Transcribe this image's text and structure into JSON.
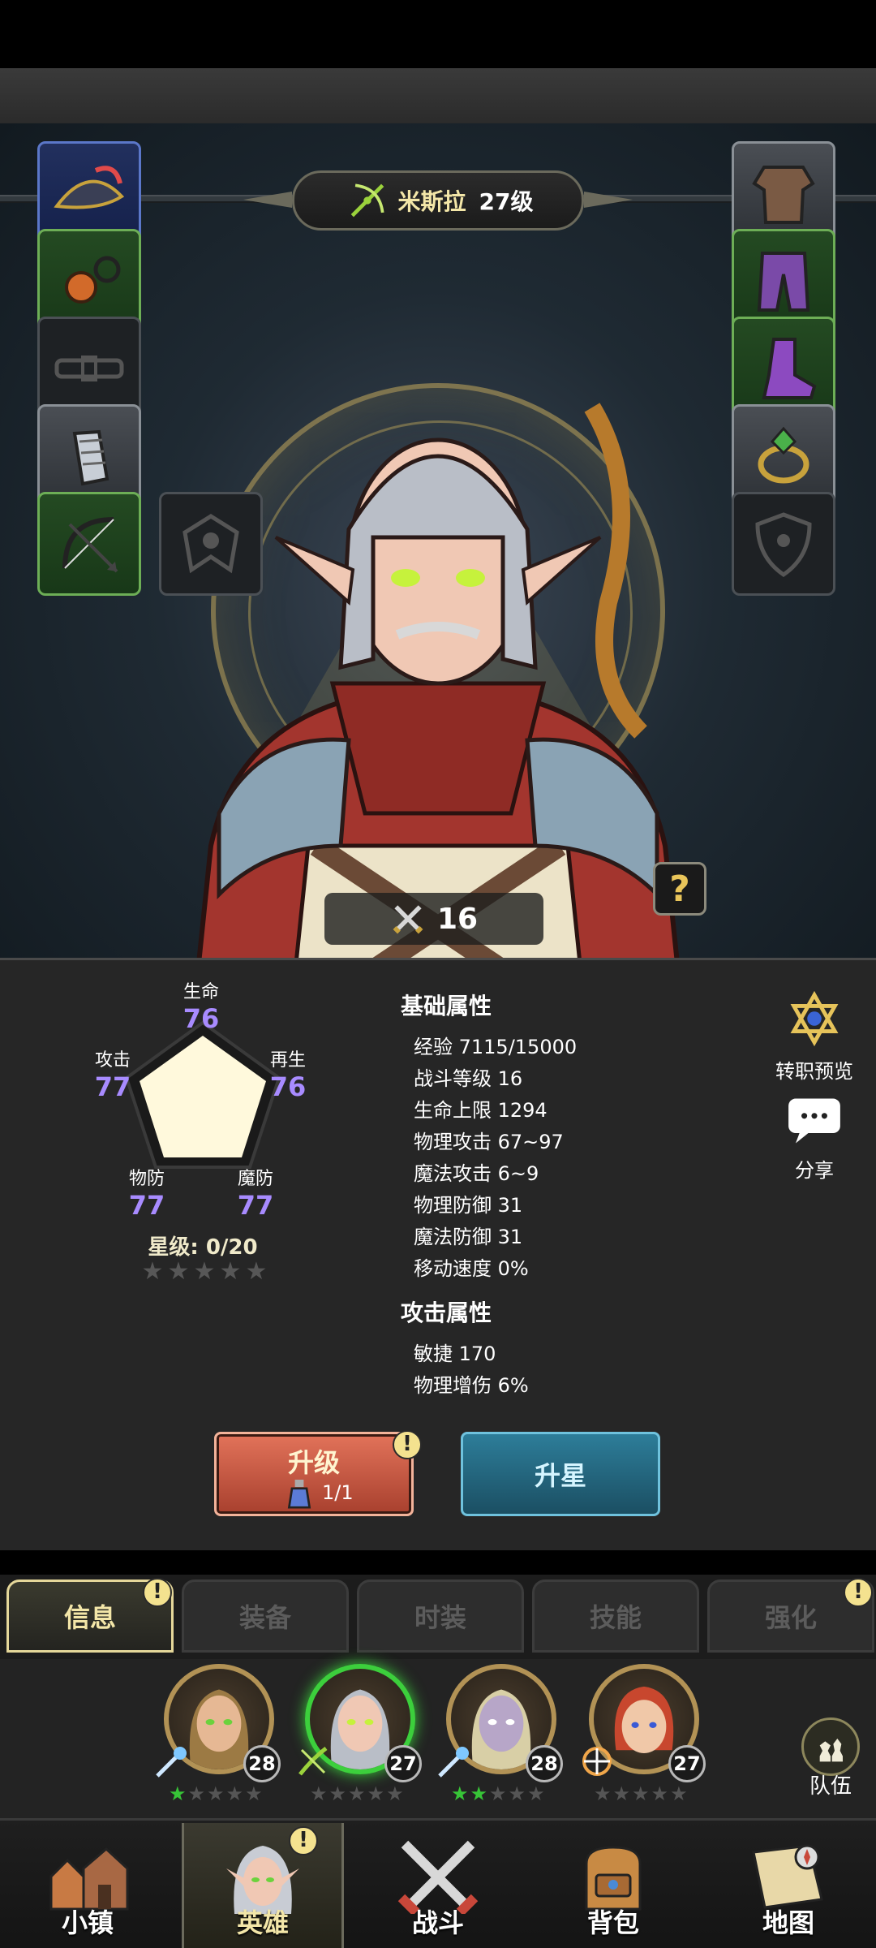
{
  "header": {
    "hero_name": "米斯拉",
    "hero_level": "27级"
  },
  "equipment": {
    "left": [
      "hat-icon",
      "amulet-icon",
      "belt-icon",
      "gauntlet-icon",
      "bow-icon"
    ],
    "right": [
      "chest-armor-icon",
      "pants-icon",
      "boots-icon",
      "ring-icon",
      "shield-icon"
    ],
    "extra": "emblem-icon"
  },
  "power": {
    "value": "16"
  },
  "radar": {
    "labels": {
      "life": "生命",
      "regen": "再生",
      "magic_def": "魔防",
      "phys_def": "物防",
      "attack": "攻击"
    },
    "values": {
      "life": "76",
      "regen": "76",
      "magic_def": "77",
      "phys_def": "77",
      "attack": "77"
    }
  },
  "star_level": {
    "label": "星级: 0/20",
    "stars_filled": 0,
    "stars_total": 5
  },
  "basic_attributes": {
    "title": "基础属性",
    "rows": [
      "经验 7115/15000",
      "战斗等级 16",
      "生命上限 1294",
      "物理攻击 67~97",
      "魔法攻击 6~9",
      "物理防御 31",
      "魔法防御 31",
      "移动速度 0%"
    ]
  },
  "attack_attributes": {
    "title": "攻击属性",
    "rows": [
      "敏捷 170",
      "物理增伤 6%"
    ]
  },
  "side_buttons": {
    "job_preview": "转职预览",
    "share": "分享"
  },
  "actions": {
    "upgrade": "升级",
    "upgrade_cost": "1/1",
    "star_up": "升星",
    "alert": "!"
  },
  "tabs": [
    "信息",
    "装备",
    "时装",
    "技能",
    "强化"
  ],
  "roster": [
    {
      "level": "28",
      "stars_on": 1
    },
    {
      "level": "27",
      "stars_on": 0
    },
    {
      "level": "28",
      "stars_on": 2
    },
    {
      "level": "27",
      "stars_on": 0
    }
  ],
  "team_label": "队伍",
  "nav": [
    "小镇",
    "英雄",
    "战斗",
    "背包",
    "地图"
  ],
  "colors": {
    "accent_gold": "#f3e6a8",
    "stat_purple": "#a88bff",
    "active_green": "#3ccf3c",
    "upgrade_red": "#c55a44",
    "star_blue": "#2d7d99"
  }
}
